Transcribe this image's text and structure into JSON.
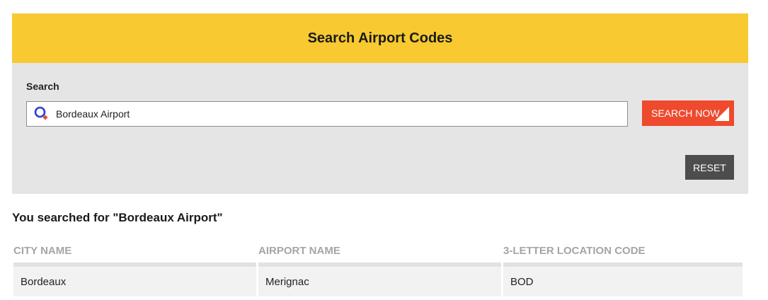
{
  "panel": {
    "title": "Search Airport Codes"
  },
  "search": {
    "label": "Search",
    "value": "Bordeaux Airport",
    "placeholder": "",
    "button_label": "SEARCH NOW",
    "reset_label": "RESET"
  },
  "results": {
    "heading": "You searched for \"Bordeaux Airport\"",
    "columns": [
      "CITY NAME",
      "AIRPORT NAME",
      "3-LETTER LOCATION CODE"
    ],
    "rows": [
      {
        "city": "Bordeaux",
        "airport": "Merignac",
        "code": "BOD"
      }
    ]
  },
  "colors": {
    "header_yellow": "#f8c930",
    "body_gray": "#e5e5e5",
    "search_button": "#ef4a2e",
    "reset_button": "#4d4d4d",
    "icon_blue": "#2b3fd1",
    "icon_accent": "#ef4a2e"
  },
  "icons": {
    "search": "search-icon",
    "button_corner": "corner-triangle-icon"
  }
}
